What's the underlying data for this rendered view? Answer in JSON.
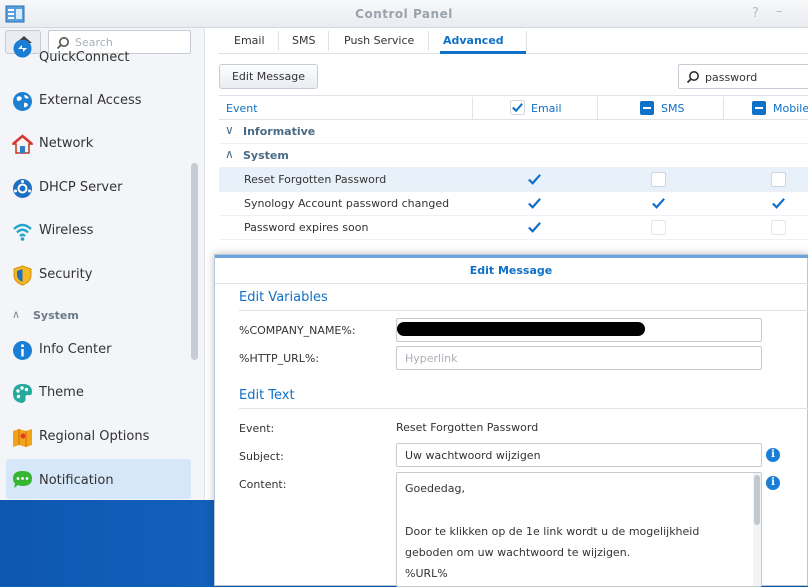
{
  "window": {
    "title": "Control Panel",
    "help_icon": "help-icon",
    "minimize_icon": "minimize-icon"
  },
  "sidebar": {
    "search_placeholder": "Search",
    "items": [
      {
        "label": "QuickConnect",
        "icon": "quickconnect-icon"
      },
      {
        "label": "External Access",
        "icon": "globe-icon"
      },
      {
        "label": "Network",
        "icon": "house-network-icon"
      },
      {
        "label": "DHCP Server",
        "icon": "dhcp-icon"
      },
      {
        "label": "Wireless",
        "icon": "wifi-icon"
      },
      {
        "label": "Security",
        "icon": "shield-icon"
      }
    ],
    "group": "System",
    "system_items": [
      {
        "label": "Info Center",
        "icon": "info-icon"
      },
      {
        "label": "Theme",
        "icon": "palette-icon"
      },
      {
        "label": "Regional Options",
        "icon": "map-icon"
      },
      {
        "label": "Notification",
        "icon": "chat-bubble-icon"
      }
    ]
  },
  "tabs": [
    "Email",
    "SMS",
    "Push Service",
    "Advanced"
  ],
  "toolbar": {
    "edit_message": "Edit Message",
    "search_value": "password"
  },
  "grid": {
    "columns": [
      "Event",
      "Email",
      "SMS",
      "Mobile"
    ],
    "groups": [
      "Informative",
      "System"
    ],
    "rows": [
      {
        "event": "Reset Forgotten Password",
        "email": true,
        "sms": false,
        "mobile": false
      },
      {
        "event": "Synology Account password changed",
        "email": true,
        "sms": true,
        "mobile": true
      },
      {
        "event": "Password expires soon",
        "email": true,
        "sms": false,
        "mobile": false
      }
    ]
  },
  "modal": {
    "title": "Edit Message",
    "variables_heading": "Edit Variables",
    "company_label": "%COMPANY_NAME%:",
    "url_label": "%HTTP_URL%:",
    "url_placeholder": "Hyperlink",
    "text_heading": "Edit Text",
    "event_label": "Event:",
    "event_value": "Reset Forgotten Password",
    "subject_label": "Subject:",
    "subject_value": "Uw wachtwoord wijzigen",
    "content_label": "Content:",
    "content_lines": [
      "Goededag,",
      "",
      "Door te klikken op de 1e link wordt u de mogelijkheid",
      "geboden om uw wachtwoord te wijzigen.",
      "%URL%"
    ]
  },
  "colors": {
    "accent": "#0e70c8",
    "selected_row": "#e8f1fa",
    "sidebar_selected": "#d5e7f9"
  }
}
